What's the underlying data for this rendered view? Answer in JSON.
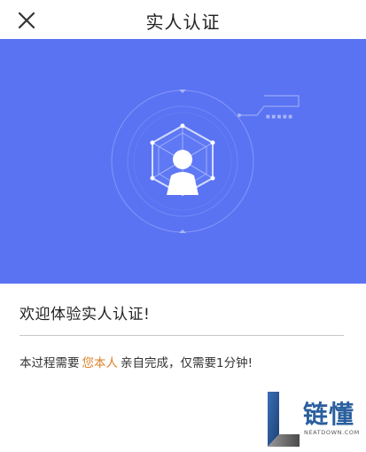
{
  "header": {
    "title": "实人认证",
    "close_icon": "close-icon"
  },
  "banner": {
    "background_color": "#5a73f3",
    "icon": "person-hexagon-icon"
  },
  "content": {
    "welcome": "欢迎体验实人认证!",
    "desc_prefix": "本过程需要",
    "desc_highlight": "您本人",
    "desc_suffix": "亲自完成，仅需要1分钟!",
    "highlight_color": "#d9822b"
  },
  "watermark": {
    "cn": "链懂",
    "en": "NEATDOWN.COM"
  }
}
